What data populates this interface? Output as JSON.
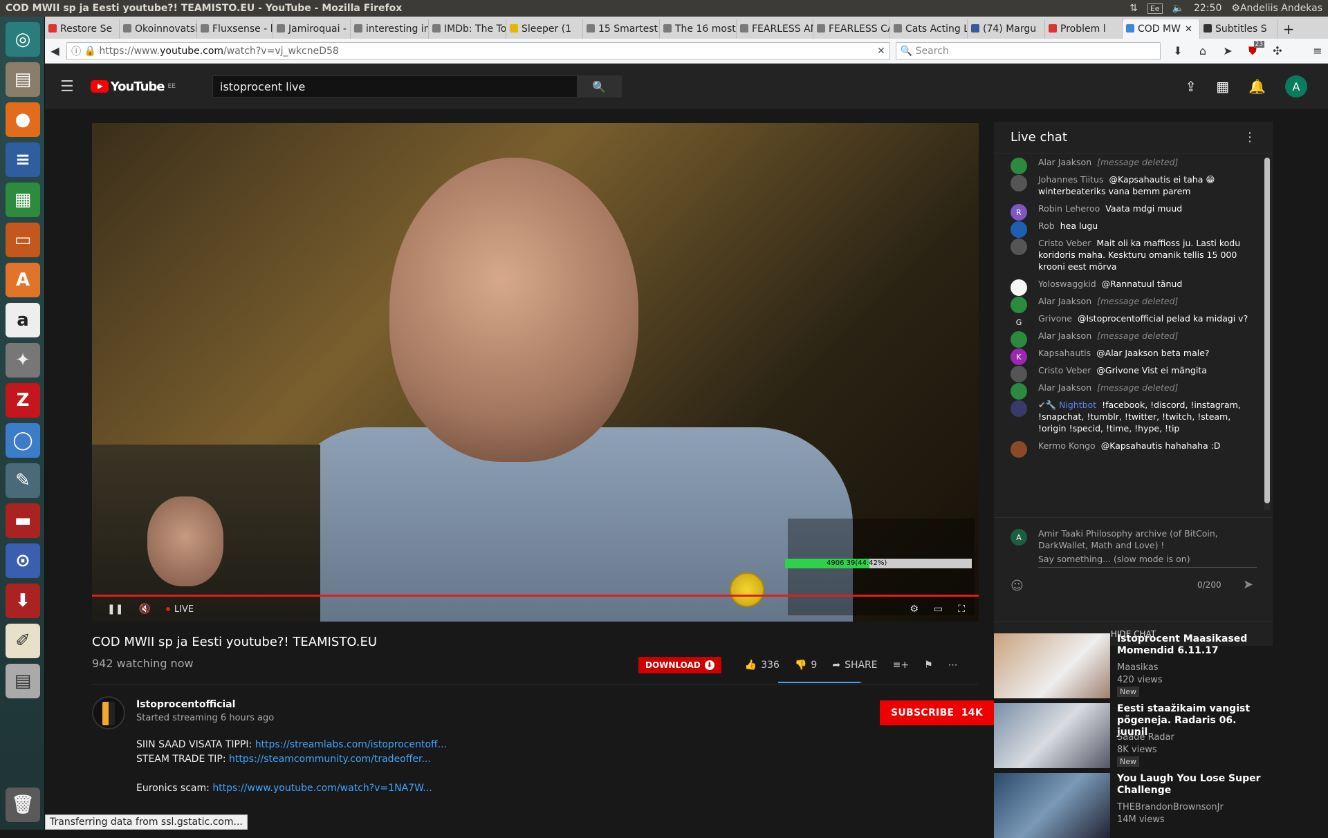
{
  "os": {
    "window_title": "COD MWII sp ja Eesti youtube?! TEAMISTO.EU - YouTube - Mozilla Firefox",
    "keyboard_layout": "Ee",
    "time": "22:50",
    "user": "Andeliis Andekas"
  },
  "browser": {
    "tabs": [
      {
        "label": "Restore Se",
        "color": "#d33"
      },
      {
        "label": "Okoinnovatsi",
        "color": "#7a7a7a"
      },
      {
        "label": "Fluxsense - lo",
        "color": "#7a7a7a"
      },
      {
        "label": "Jamiroquai - ",
        "color": "#7a7a7a"
      },
      {
        "label": "interesting in",
        "color": "#7a7a7a"
      },
      {
        "label": "IMDb: The Top",
        "color": "#7a7a7a"
      },
      {
        "label": "Sleeper (1",
        "color": "#e8b500"
      },
      {
        "label": "15 Smartest S",
        "color": "#7a7a7a"
      },
      {
        "label": "The 16 most i",
        "color": "#7a7a7a"
      },
      {
        "label": "FEARLESS AN",
        "color": "#7a7a7a"
      },
      {
        "label": "FEARLESS CA",
        "color": "#7a7a7a"
      },
      {
        "label": "Cats Acting Li",
        "color": "#7a7a7a"
      },
      {
        "label": "(74) Margu",
        "color": "#3b5998"
      },
      {
        "label": "Problem l",
        "color": "#d33"
      },
      {
        "label": "COD MW",
        "color": "#3a88d8",
        "active": true
      },
      {
        "label": "Subtitles S",
        "color": "#333"
      }
    ],
    "url_prefix": "https://www.",
    "url_host": "youtube.com",
    "url_path": "/watch?v=vj_wkcneD58",
    "search_placeholder": "Search",
    "addon_badge": "23",
    "status": "Transferring data from ssl.gstatic.com..."
  },
  "yt": {
    "logo_text": "YouTube",
    "region": "EE",
    "search_value": "istoprocent live",
    "avatar_letter": "A",
    "video": {
      "title": "COD MWII sp ja Eesti youtube?! TEAMISTO.EU",
      "watching": "942 watching now",
      "live_label": "LIVE",
      "likes": "336",
      "dislikes": "9",
      "download_label": "DOWNLOAD",
      "share_label": "SHARE",
      "hp_text": "4906 39(44.42%)",
      "hp_fraction": 0.45
    },
    "channel": {
      "name": "Istoprocentofficial",
      "started": "Started streaming 6 hours ago",
      "subscribe_label": "SUBSCRIBE",
      "subscribers": "14K"
    },
    "description": {
      "line1_text": "SIIN SAAD VISATA TIPPI: ",
      "line1_link": "https://streamlabs.com/istoprocentoff...",
      "line2_text": "STEAM TRADE TIP: ",
      "line2_link": "https://steamcommunity.com/tradeoffer...",
      "line3_text": "Euronics scam: ",
      "line3_link": "https://www.youtube.com/watch?v=1NA7W..."
    },
    "chat": {
      "title": "Live chat",
      "messages": [
        {
          "author": "Alar Jaakson",
          "text": "[message deleted]",
          "deleted": true,
          "color": "#2b8a3e",
          "initial": ""
        },
        {
          "author": "Johannes Tiitus",
          "text": "@Kapsahautis ei taha 😁 winterbeateriks vana bemm parem",
          "color": "#555",
          "initial": ""
        },
        {
          "author": "Robin Leheroo",
          "text": "Vaata mdgi muud",
          "color": "#7e57c2",
          "initial": "R"
        },
        {
          "author": "Rob",
          "text": "hea lugu",
          "color": "#1e5fb0",
          "initial": ""
        },
        {
          "author": "Cristo Veber",
          "text": "Mait oli ka maffioss ju. Lasti kodu koridoris maha. Keskturu omanik tellis 15 000 krooni eest mõrva",
          "color": "#555",
          "initial": ""
        },
        {
          "author": "Yoloswaggkid",
          "text": "@Rannatuul tänud",
          "color": "#f5f5f5",
          "initial": ""
        },
        {
          "author": "Alar Jaakson",
          "text": "[message deleted]",
          "deleted": true,
          "color": "#2b8a3e",
          "initial": ""
        },
        {
          "author": "Grivone",
          "text": "@Istoprocentofficial pelad ka midagi v?",
          "color": "#222",
          "initial": "G"
        },
        {
          "author": "Alar Jaakson",
          "text": "[message deleted]",
          "deleted": true,
          "color": "#2b8a3e",
          "initial": ""
        },
        {
          "author": "Kapsahautis",
          "text": "@Alar Jaakson beta male?",
          "color": "#9c27b0",
          "initial": "K"
        },
        {
          "author": "Cristo Veber",
          "text": "@Grivone Vist ei mängita",
          "color": "#555",
          "initial": ""
        },
        {
          "author": "Alar Jaakson",
          "text": "[message deleted]",
          "deleted": true,
          "color": "#2b8a3e",
          "initial": ""
        },
        {
          "author": "Nightbot",
          "text": "!facebook, !discord, !instagram, !snapchat, !tumblr, !twitter, !twitch, !steam, !origin !specid, !time, !hype, !tip",
          "bot": true,
          "color": "#3a3a6a",
          "initial": ""
        },
        {
          "author": "Kermo Kongo",
          "text": "@Kapsahautis hahahaha :D",
          "color": "#8a4a2a",
          "initial": ""
        }
      ],
      "composer_author": "Amir Taaki Philosophy archive (of BitCoin, DarkWallet, Math and Love) !",
      "composer_initial": "A",
      "input_placeholder": "Say something... (slow mode is on)",
      "char_count": "0/200",
      "hide_label": "HIDE CHAT"
    },
    "recommendations": [
      {
        "title": "Istoprocent Maasikased Momendid 6.11.17",
        "channel": "Maasikas",
        "views": "420 views",
        "badge": "New"
      },
      {
        "title": "Eesti staažikaim vangist põgeneja. Radaris 06. juunil",
        "channel": "Saade Radar",
        "views": "8K views",
        "badge": "New"
      },
      {
        "title": "You Laugh You Lose Super Challenge",
        "channel": "THEBrandonBrownsonJr",
        "views": "14M views",
        "badge": ""
      }
    ]
  }
}
